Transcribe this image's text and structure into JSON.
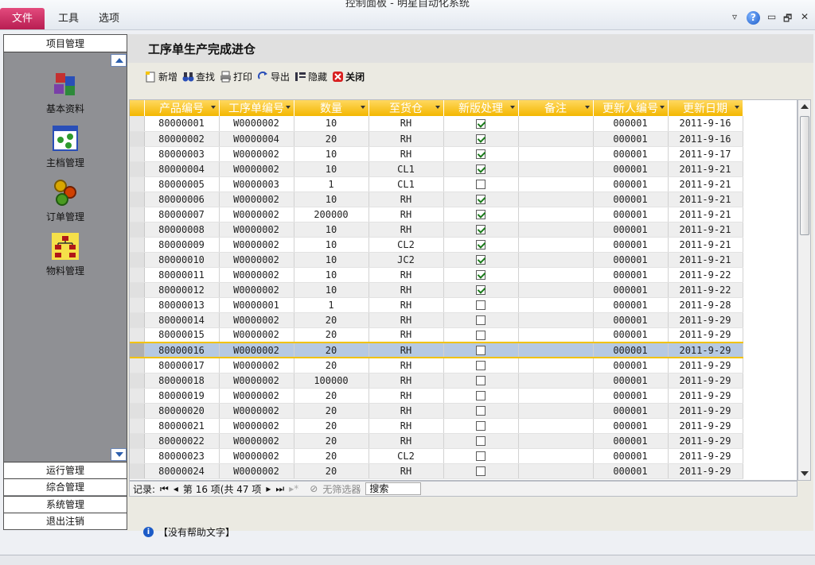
{
  "window": {
    "title": "控制面板 - 明星自动化系统"
  },
  "menu": {
    "file": "文件",
    "tools": "工具",
    "options": "选项"
  },
  "win_controls": {
    "dropdown": "▿",
    "help": "?",
    "minimize": "▭",
    "restore": "🗗",
    "close": "✕"
  },
  "nav": {
    "header": "项目管理",
    "items": [
      {
        "label": "基本资料",
        "icon": "cubes-icon"
      },
      {
        "label": "主档管理",
        "icon": "window-dots-icon"
      },
      {
        "label": "订单管理",
        "icon": "gears-icon"
      },
      {
        "label": "物料管理",
        "icon": "org-chart-icon"
      }
    ],
    "sections": [
      "运行管理",
      "综合管理",
      "系统管理",
      "退出注销"
    ]
  },
  "page": {
    "title": "工序单生产完成进仓"
  },
  "toolbar": {
    "new": "新增",
    "find": "查找",
    "print": "打印",
    "export": "导出",
    "hide": "隐藏",
    "close": "关闭"
  },
  "grid": {
    "columns": [
      "产品编号",
      "工序单编号",
      "数量",
      "至货仓",
      "新版处理",
      "备注",
      "更新人编号",
      "更新日期"
    ],
    "rows": [
      [
        "80000001",
        "W0000002",
        "10",
        "RH",
        true,
        "",
        "000001",
        "2011-9-16"
      ],
      [
        "80000002",
        "W0000004",
        "20",
        "RH",
        true,
        "",
        "000001",
        "2011-9-16"
      ],
      [
        "80000003",
        "W0000002",
        "10",
        "RH",
        true,
        "",
        "000001",
        "2011-9-17"
      ],
      [
        "80000004",
        "W0000002",
        "10",
        "CL1",
        true,
        "",
        "000001",
        "2011-9-21"
      ],
      [
        "80000005",
        "W0000003",
        "1",
        "CL1",
        false,
        "",
        "000001",
        "2011-9-21"
      ],
      [
        "80000006",
        "W0000002",
        "10",
        "RH",
        true,
        "",
        "000001",
        "2011-9-21"
      ],
      [
        "80000007",
        "W0000002",
        "200000",
        "RH",
        true,
        "",
        "000001",
        "2011-9-21"
      ],
      [
        "80000008",
        "W0000002",
        "10",
        "RH",
        true,
        "",
        "000001",
        "2011-9-21"
      ],
      [
        "80000009",
        "W0000002",
        "10",
        "CL2",
        true,
        "",
        "000001",
        "2011-9-21"
      ],
      [
        "80000010",
        "W0000002",
        "10",
        "JC2",
        true,
        "",
        "000001",
        "2011-9-21"
      ],
      [
        "80000011",
        "W0000002",
        "10",
        "RH",
        true,
        "",
        "000001",
        "2011-9-22"
      ],
      [
        "80000012",
        "W0000002",
        "10",
        "RH",
        true,
        "",
        "000001",
        "2011-9-22"
      ],
      [
        "80000013",
        "W0000001",
        "1",
        "RH",
        false,
        "",
        "000001",
        "2011-9-28"
      ],
      [
        "80000014",
        "W0000002",
        "20",
        "RH",
        false,
        "",
        "000001",
        "2011-9-29"
      ],
      [
        "80000015",
        "W0000002",
        "20",
        "RH",
        false,
        "",
        "000001",
        "2011-9-29"
      ],
      [
        "80000016",
        "W0000002",
        "20",
        "RH",
        false,
        "",
        "000001",
        "2011-9-29"
      ],
      [
        "80000017",
        "W0000002",
        "20",
        "RH",
        false,
        "",
        "000001",
        "2011-9-29"
      ],
      [
        "80000018",
        "W0000002",
        "100000",
        "RH",
        false,
        "",
        "000001",
        "2011-9-29"
      ],
      [
        "80000019",
        "W0000002",
        "20",
        "RH",
        false,
        "",
        "000001",
        "2011-9-29"
      ],
      [
        "80000020",
        "W0000002",
        "20",
        "RH",
        false,
        "",
        "000001",
        "2011-9-29"
      ],
      [
        "80000021",
        "W0000002",
        "20",
        "RH",
        false,
        "",
        "000001",
        "2011-9-29"
      ],
      [
        "80000022",
        "W0000002",
        "20",
        "RH",
        false,
        "",
        "000001",
        "2011-9-29"
      ],
      [
        "80000023",
        "W0000002",
        "20",
        "CL2",
        false,
        "",
        "000001",
        "2011-9-29"
      ],
      [
        "80000024",
        "W0000002",
        "20",
        "RH",
        false,
        "",
        "000001",
        "2011-9-29"
      ]
    ],
    "current_row": 15
  },
  "statusbar": {
    "record_label": "记录:",
    "position": "第 16 项(共 47 项",
    "filter": "无筛选器",
    "search_placeholder": "搜索"
  },
  "help": {
    "text": "【没有帮助文字】"
  }
}
